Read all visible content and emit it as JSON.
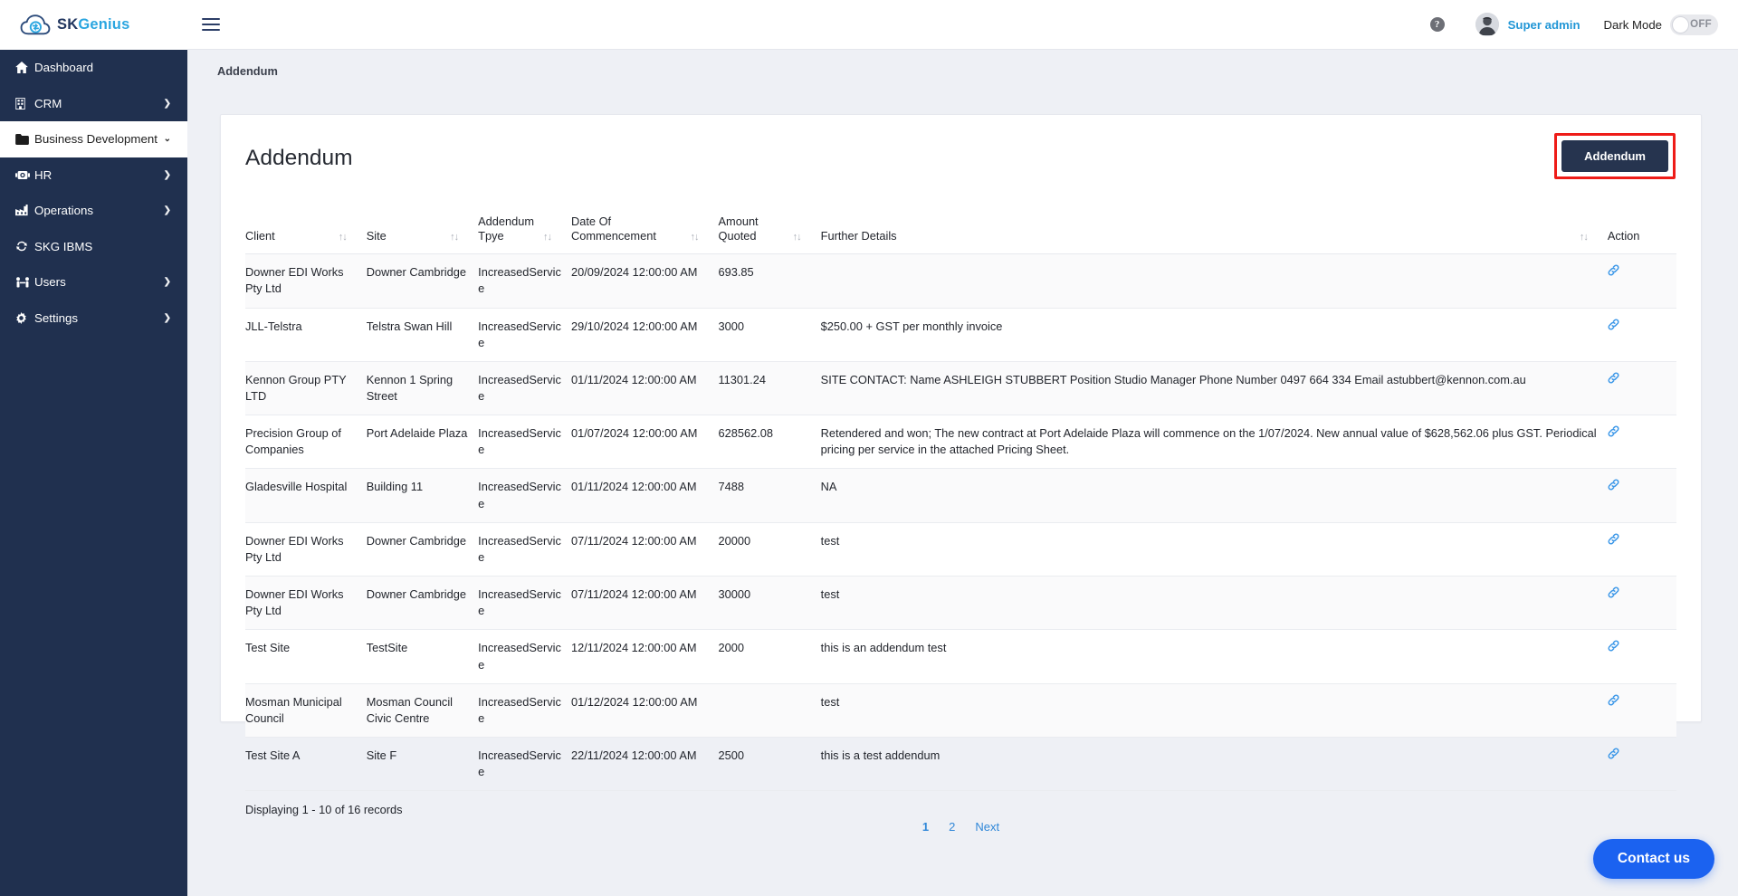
{
  "brand": {
    "name_part1": "SK",
    "name_part2": "Genius",
    "logo_icon": "cloud-refresh-icon"
  },
  "sidebar": {
    "items": [
      {
        "label": "Dashboard",
        "icon": "home-icon",
        "caret": "",
        "active": false
      },
      {
        "label": "CRM",
        "icon": "building-icon",
        "caret": "❯",
        "active": false
      },
      {
        "label": "Business Development",
        "icon": "folder-icon",
        "caret": "⌄",
        "active": true
      },
      {
        "label": "HR",
        "icon": "badge-icon",
        "caret": "❯",
        "active": false
      },
      {
        "label": "Operations",
        "icon": "factory-icon",
        "caret": "❯",
        "active": false
      },
      {
        "label": "SKG IBMS",
        "icon": "refresh-icon",
        "caret": "",
        "active": false
      },
      {
        "label": "Users",
        "icon": "users-icon",
        "caret": "❯",
        "active": false
      },
      {
        "label": "Settings",
        "icon": "gear-icon",
        "caret": "❯",
        "active": false
      }
    ]
  },
  "topbar": {
    "menu_icon": "hamburger-icon",
    "help_icon": "help-circle-icon",
    "help_glyph": "?",
    "avatar_icon": "user-avatar",
    "user_name": "Super admin",
    "dark_mode_label": "Dark Mode",
    "dark_mode_state": "OFF"
  },
  "breadcrumb": {
    "text": "Addendum"
  },
  "main": {
    "page_title": "Addendum",
    "primary_button": "Addendum",
    "highlight_color": "#ee1c18",
    "button_color": "#26344f"
  },
  "table": {
    "sort_glyph": "↑↓",
    "link_glyph": "🔗",
    "columns": [
      {
        "label": "Client",
        "sortable": true
      },
      {
        "label": "Site",
        "sortable": true
      },
      {
        "label": "Addendum\nTpye",
        "sortable": true
      },
      {
        "label": "Date Of\nCommencement",
        "sortable": true
      },
      {
        "label": "Amount\nQuoted",
        "sortable": true
      },
      {
        "label": "Further Details",
        "sortable": true
      },
      {
        "label": "Action",
        "sortable": false
      }
    ],
    "rows": [
      {
        "client": "Downer EDI Works Pty Ltd",
        "site": "Downer Cambridge",
        "type": "IncreasedService",
        "date": "20/09/2024 12:00:00 AM",
        "amount": "693.85",
        "details": ""
      },
      {
        "client": "JLL-Telstra",
        "site": "Telstra Swan Hill",
        "type": "IncreasedService",
        "date": "29/10/2024 12:00:00 AM",
        "amount": "3000",
        "details": "$250.00 + GST per monthly invoice"
      },
      {
        "client": "Kennon Group PTY LTD",
        "site": "Kennon 1 Spring Street",
        "type": "IncreasedService",
        "date": "01/11/2024 12:00:00 AM",
        "amount": "11301.24",
        "details": "SITE CONTACT: Name ASHLEIGH STUBBERT Position Studio Manager Phone Number 0497 664 334 Email astubbert@kennon.com.au"
      },
      {
        "client": "Precision Group of Companies",
        "site": "Port Adelaide Plaza",
        "type": "IncreasedService",
        "date": "01/07/2024 12:00:00 AM",
        "amount": "628562.08",
        "details": "Retendered and won; The new contract at Port Adelaide Plaza will commence on the 1/07/2024. New annual value of $628,562.06 plus GST. Periodical pricing per service in the attached Pricing Sheet."
      },
      {
        "client": "Gladesville Hospital",
        "site": "Building 11",
        "type": "IncreasedService",
        "date": "01/11/2024 12:00:00 AM",
        "amount": "7488",
        "details": "NA"
      },
      {
        "client": "Downer EDI Works Pty Ltd",
        "site": "Downer Cambridge",
        "type": "IncreasedService",
        "date": "07/11/2024 12:00:00 AM",
        "amount": "20000",
        "details": "test"
      },
      {
        "client": "Downer EDI Works Pty Ltd",
        "site": "Downer Cambridge",
        "type": "IncreasedService",
        "date": "07/11/2024 12:00:00 AM",
        "amount": "30000",
        "details": "test"
      },
      {
        "client": "Test Site",
        "site": "TestSite",
        "type": "IncreasedService",
        "date": "12/11/2024 12:00:00 AM",
        "amount": "2000",
        "details": "this is an addendum test"
      },
      {
        "client": "Mosman Municipal Council",
        "site": "Mosman Council Civic Centre",
        "type": "IncreasedService",
        "date": "01/12/2024 12:00:00 AM",
        "amount": "",
        "details": "test"
      },
      {
        "client": "Test Site A",
        "site": "Site F",
        "type": "IncreasedService",
        "date": "22/11/2024 12:00:00 AM",
        "amount": "2500",
        "details": "this is a test addendum"
      }
    ],
    "footer_text": "Displaying 1 - 10 of 16 records",
    "pagination": [
      {
        "label": "1",
        "current": true
      },
      {
        "label": "2",
        "current": false
      },
      {
        "label": "Next",
        "current": false
      }
    ]
  },
  "contact": {
    "label": "Contact us"
  }
}
